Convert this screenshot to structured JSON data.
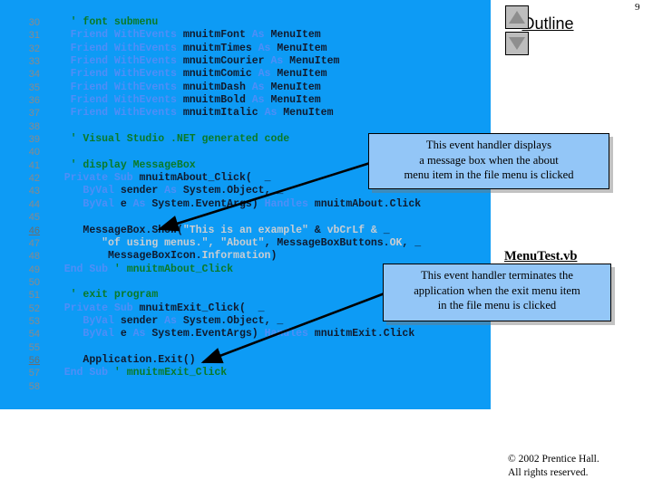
{
  "header": {
    "title": "Outline",
    "page_number": "9",
    "nav_up_icon": "triangle-up-icon",
    "nav_down_icon": "triangle-down-icon"
  },
  "file_label": "MenuTest.vb",
  "copyright": {
    "line1": "© 2002 Prentice Hall.",
    "line2": "All rights reserved."
  },
  "colors": {
    "panel_background": "#0D9BF5",
    "callout_background": "#93C6F7",
    "comment": "#0A7A28",
    "keyword": "#4F8EF7",
    "identifier": "#101A2E",
    "string": "#C9CDD2",
    "line_number": "#8A8A8A"
  },
  "code": {
    "language": "Visual Basic .NET",
    "lines": [
      {
        "num": "30",
        "highlight": false,
        "tokens": [
          {
            "t": "    ",
            "c": "op"
          },
          {
            "t": "' font submenu",
            "c": "cmt"
          }
        ]
      },
      {
        "num": "31",
        "highlight": false,
        "tokens": [
          {
            "t": "    ",
            "c": "op"
          },
          {
            "t": "Friend WithEvents",
            "c": "kw"
          },
          {
            "t": " mnuitmFont ",
            "c": "id"
          },
          {
            "t": "As",
            "c": "kw"
          },
          {
            "t": " MenuItem",
            "c": "id"
          }
        ]
      },
      {
        "num": "32",
        "highlight": false,
        "tokens": [
          {
            "t": "    ",
            "c": "op"
          },
          {
            "t": "Friend WithEvents",
            "c": "kw"
          },
          {
            "t": " mnuitmTimes ",
            "c": "id"
          },
          {
            "t": "As",
            "c": "kw"
          },
          {
            "t": " MenuItem",
            "c": "id"
          }
        ]
      },
      {
        "num": "33",
        "highlight": false,
        "tokens": [
          {
            "t": "    ",
            "c": "op"
          },
          {
            "t": "Friend WithEvents",
            "c": "kw"
          },
          {
            "t": " mnuitmCourier ",
            "c": "id"
          },
          {
            "t": "As",
            "c": "kw"
          },
          {
            "t": " MenuItem",
            "c": "id"
          }
        ]
      },
      {
        "num": "34",
        "highlight": false,
        "tokens": [
          {
            "t": "    ",
            "c": "op"
          },
          {
            "t": "Friend WithEvents",
            "c": "kw"
          },
          {
            "t": " mnuitmComic ",
            "c": "id"
          },
          {
            "t": "As",
            "c": "kw"
          },
          {
            "t": " MenuItem",
            "c": "id"
          }
        ]
      },
      {
        "num": "35",
        "highlight": false,
        "tokens": [
          {
            "t": "    ",
            "c": "op"
          },
          {
            "t": "Friend WithEvents",
            "c": "kw"
          },
          {
            "t": " mnuitmDash ",
            "c": "id"
          },
          {
            "t": "As",
            "c": "kw"
          },
          {
            "t": " MenuItem",
            "c": "id"
          }
        ]
      },
      {
        "num": "36",
        "highlight": false,
        "tokens": [
          {
            "t": "    ",
            "c": "op"
          },
          {
            "t": "Friend WithEvents",
            "c": "kw"
          },
          {
            "t": " mnuitmBold ",
            "c": "id"
          },
          {
            "t": "As",
            "c": "kw"
          },
          {
            "t": " MenuItem",
            "c": "id"
          }
        ]
      },
      {
        "num": "37",
        "highlight": false,
        "tokens": [
          {
            "t": "    ",
            "c": "op"
          },
          {
            "t": "Friend WithEvents",
            "c": "kw"
          },
          {
            "t": " mnuitmItalic ",
            "c": "id"
          },
          {
            "t": "As",
            "c": "kw"
          },
          {
            "t": " MenuItem",
            "c": "id"
          }
        ]
      },
      {
        "num": "38",
        "highlight": false,
        "tokens": []
      },
      {
        "num": "39",
        "highlight": false,
        "tokens": [
          {
            "t": "    ",
            "c": "op"
          },
          {
            "t": "' Visual Studio .NET generated code",
            "c": "cmt"
          }
        ]
      },
      {
        "num": "40",
        "highlight": false,
        "tokens": []
      },
      {
        "num": "41",
        "highlight": false,
        "tokens": [
          {
            "t": "    ",
            "c": "op"
          },
          {
            "t": "' display MessageBox",
            "c": "cmt"
          }
        ]
      },
      {
        "num": "42",
        "highlight": false,
        "tokens": [
          {
            "t": "   ",
            "c": "op"
          },
          {
            "t": "Private Sub",
            "c": "kw"
          },
          {
            "t": " mnuitmAbout_Click(  _",
            "c": "id"
          }
        ]
      },
      {
        "num": "43",
        "highlight": false,
        "tokens": [
          {
            "t": "      ",
            "c": "op"
          },
          {
            "t": "ByVal",
            "c": "kw"
          },
          {
            "t": " sender ",
            "c": "id"
          },
          {
            "t": "As",
            "c": "kw"
          },
          {
            "t": " System.Object, _",
            "c": "id"
          }
        ]
      },
      {
        "num": "44",
        "highlight": false,
        "tokens": [
          {
            "t": "      ",
            "c": "op"
          },
          {
            "t": "ByVal",
            "c": "kw"
          },
          {
            "t": " e ",
            "c": "id"
          },
          {
            "t": "As",
            "c": "kw"
          },
          {
            "t": " System.EventArgs) ",
            "c": "id"
          },
          {
            "t": "Handles",
            "c": "kw"
          },
          {
            "t": " mnuitmAbout.Click",
            "c": "id"
          }
        ]
      },
      {
        "num": "45",
        "highlight": false,
        "tokens": []
      },
      {
        "num": "46",
        "highlight": true,
        "tokens": [
          {
            "t": "      ",
            "c": "op"
          },
          {
            "t": "MessageBox.Show(",
            "c": "id"
          },
          {
            "t": "\"This is an example\"",
            "c": "str"
          },
          {
            "t": " & ",
            "c": "id"
          },
          {
            "t": "vbCrLf &",
            "c": "str"
          },
          {
            "t": " _",
            "c": "id"
          }
        ]
      },
      {
        "num": "47",
        "highlight": false,
        "tokens": [
          {
            "t": "         ",
            "c": "op"
          },
          {
            "t": "\"of using menus.\", \"About\"",
            "c": "str"
          },
          {
            "t": ", MessageBoxButtons.",
            "c": "id"
          },
          {
            "t": "OK",
            "c": "str"
          },
          {
            "t": ", _",
            "c": "id"
          }
        ]
      },
      {
        "num": "48",
        "highlight": false,
        "tokens": [
          {
            "t": "          ",
            "c": "op"
          },
          {
            "t": "MessageBoxIcon.",
            "c": "id"
          },
          {
            "t": "Information",
            "c": "str"
          },
          {
            "t": ")",
            "c": "id"
          }
        ]
      },
      {
        "num": "49",
        "highlight": false,
        "tokens": [
          {
            "t": "   ",
            "c": "op"
          },
          {
            "t": "End Sub",
            "c": "kw"
          },
          {
            "t": " ' mnuitmAbout_Click",
            "c": "cmt"
          }
        ]
      },
      {
        "num": "50",
        "highlight": false,
        "tokens": []
      },
      {
        "num": "51",
        "highlight": false,
        "tokens": [
          {
            "t": "    ",
            "c": "op"
          },
          {
            "t": "' exit program",
            "c": "cmt"
          }
        ]
      },
      {
        "num": "52",
        "highlight": false,
        "tokens": [
          {
            "t": "   ",
            "c": "op"
          },
          {
            "t": "Private Sub",
            "c": "kw"
          },
          {
            "t": " mnuitmExit_Click(  _",
            "c": "id"
          }
        ]
      },
      {
        "num": "53",
        "highlight": false,
        "tokens": [
          {
            "t": "      ",
            "c": "op"
          },
          {
            "t": "ByVal",
            "c": "kw"
          },
          {
            "t": " sender ",
            "c": "id"
          },
          {
            "t": "As",
            "c": "kw"
          },
          {
            "t": " System.Object, _",
            "c": "id"
          }
        ]
      },
      {
        "num": "54",
        "highlight": false,
        "tokens": [
          {
            "t": "      ",
            "c": "op"
          },
          {
            "t": "ByVal",
            "c": "kw"
          },
          {
            "t": " e ",
            "c": "id"
          },
          {
            "t": "As",
            "c": "kw"
          },
          {
            "t": " System.EventArgs) ",
            "c": "id"
          },
          {
            "t": "Handles",
            "c": "kw"
          },
          {
            "t": " mnuitmExit.Click",
            "c": "id"
          }
        ]
      },
      {
        "num": "55",
        "highlight": false,
        "tokens": []
      },
      {
        "num": "56",
        "highlight": true,
        "tokens": [
          {
            "t": "      ",
            "c": "op"
          },
          {
            "t": "Application.Exit()",
            "c": "id"
          }
        ]
      },
      {
        "num": "57",
        "highlight": false,
        "tokens": [
          {
            "t": "   ",
            "c": "op"
          },
          {
            "t": "End Sub",
            "c": "kw"
          },
          {
            "t": " ' mnuitmExit_Click",
            "c": "cmt"
          }
        ]
      },
      {
        "num": "58",
        "highlight": false,
        "tokens": []
      }
    ]
  },
  "callouts": [
    {
      "id": "about",
      "lines": [
        "This event handler displays",
        "a message box when the about",
        "menu item in the file menu is clicked"
      ]
    },
    {
      "id": "exit",
      "lines": [
        "This event handler terminates the",
        "application when the exit menu item",
        "in the file menu is clicked"
      ]
    }
  ]
}
